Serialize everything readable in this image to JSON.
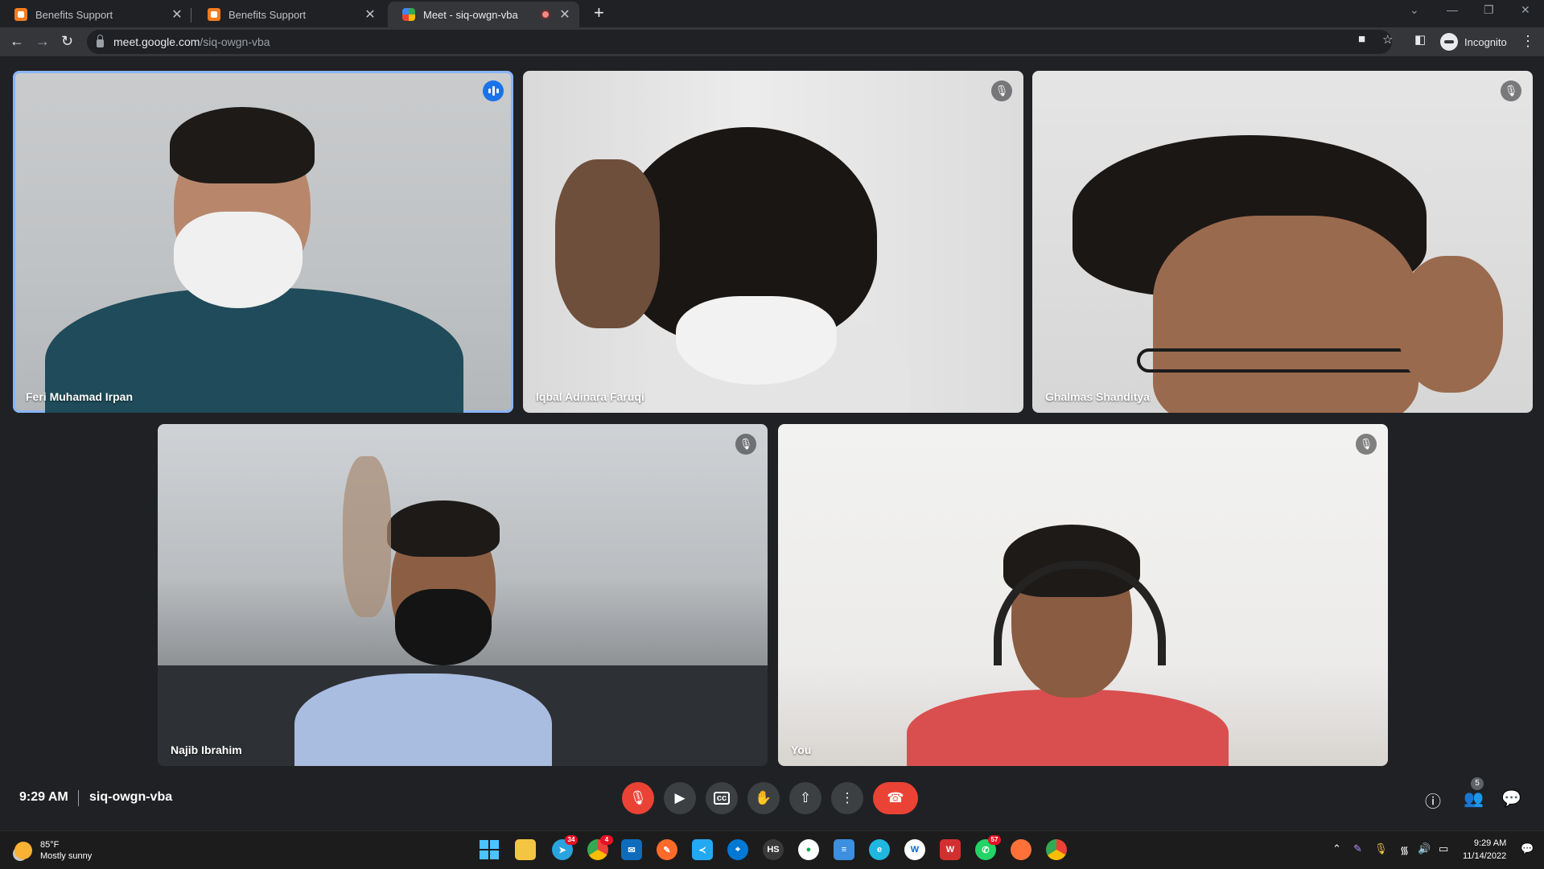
{
  "browser": {
    "tabs": [
      {
        "title": "Benefits Support",
        "favicon": "benefits-favicon",
        "active": false
      },
      {
        "title": "Benefits Support",
        "favicon": "benefits-favicon",
        "active": false
      },
      {
        "title": "Meet - siq-owgn-vba",
        "favicon": "google-meet-favicon",
        "active": true,
        "recording": true
      }
    ],
    "url_host": "meet.google.com",
    "url_path": "/siq-owgn-vba",
    "profile_label": "Incognito"
  },
  "meet": {
    "participants": [
      {
        "name": "Feri Muhamad Irpan",
        "speaking": true,
        "muted": false
      },
      {
        "name": "Iqbal Adinara Faruqi",
        "speaking": false,
        "muted": true
      },
      {
        "name": "Ghalmas Shanditya",
        "speaking": false,
        "muted": true
      },
      {
        "name": "Najib Ibrahim",
        "speaking": false,
        "muted": true
      },
      {
        "name": "You",
        "speaking": false,
        "muted": true
      }
    ],
    "time": "9:29 AM",
    "meeting_code": "siq-owgn-vba",
    "people_count": "5",
    "colors": {
      "accent": "#8ab4f8",
      "danger": "#ea4335",
      "speaking": "#1a73e8"
    }
  },
  "taskbar": {
    "weather_temp": "85°F",
    "weather_desc": "Mostly sunny",
    "time": "9:29 AM",
    "date": "11/14/2022",
    "badges": {
      "telegram": "34",
      "chrome": "4",
      "whatsapp": "57"
    }
  }
}
